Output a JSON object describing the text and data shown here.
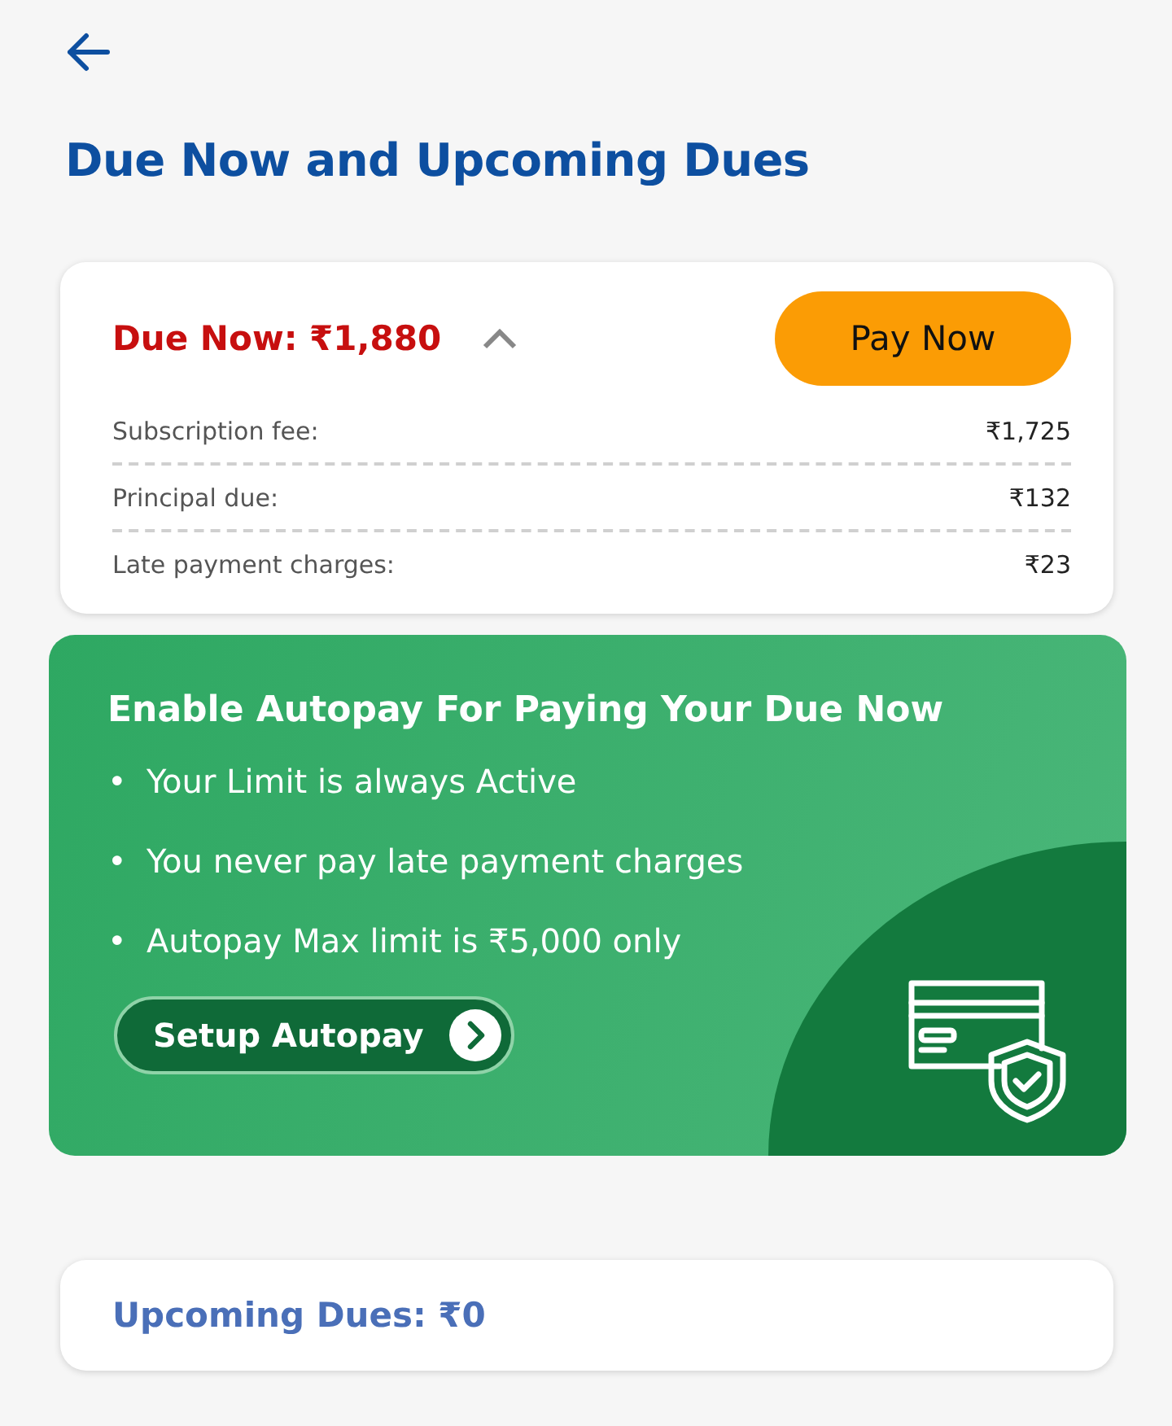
{
  "page": {
    "title": "Due Now and Upcoming Dues"
  },
  "due_now": {
    "label": "Due Now: ₹1,880",
    "expanded": true,
    "pay_button": "Pay Now",
    "breakdown": [
      {
        "label": "Subscription fee:",
        "amount": "₹1,725"
      },
      {
        "label": "Principal due:",
        "amount": "₹132"
      },
      {
        "label": "Late payment charges:",
        "amount": "₹23"
      }
    ]
  },
  "autopay_banner": {
    "title": "Enable Autopay For Paying Your Due Now",
    "points": [
      {
        "bullet": "•",
        "text": "Your Limit is always Active"
      },
      {
        "bullet": "•",
        "text": "You never pay late payment charges"
      },
      {
        "bullet": "•",
        "text": "Autopay Max limit is ₹5,000 only"
      }
    ],
    "button": "Setup Autopay"
  },
  "upcoming": {
    "label": "Upcoming Dues: ₹0"
  }
}
